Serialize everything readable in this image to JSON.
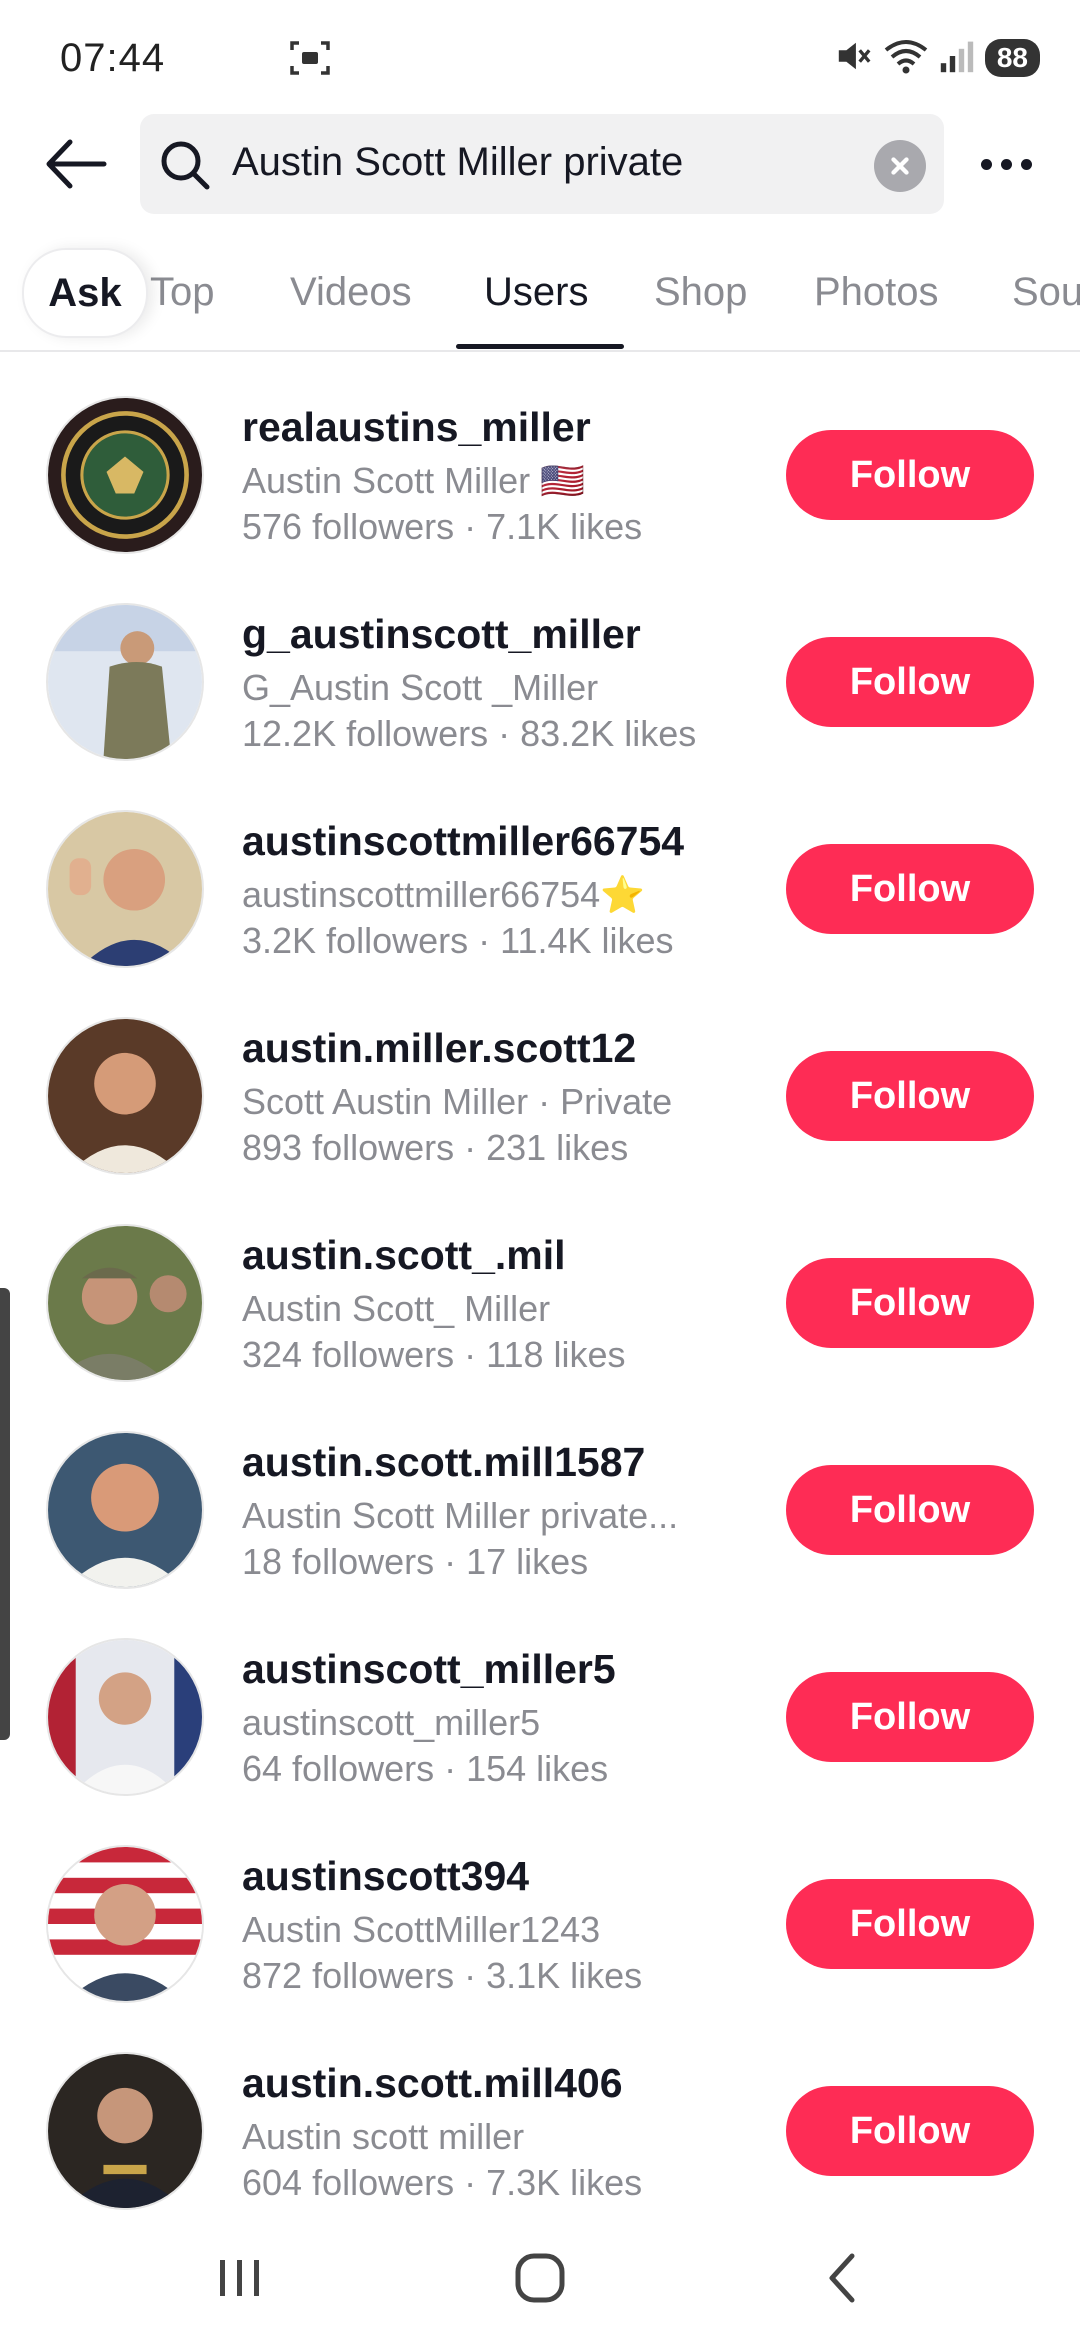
{
  "status_bar": {
    "time": "07:44",
    "battery": "88",
    "icons": [
      "screen-record-icon",
      "mute-icon",
      "wifi-icon",
      "signal-icon"
    ]
  },
  "search": {
    "query": "Austin Scott Miller private",
    "icons": [
      "back-arrow-icon",
      "search-icon",
      "clear-icon",
      "more-icon"
    ]
  },
  "tabs": [
    {
      "label": "Ask"
    },
    {
      "label": "Top"
    },
    {
      "label": "Videos"
    },
    {
      "label": "Users",
      "active": true
    },
    {
      "label": "Shop"
    },
    {
      "label": "Photos"
    },
    {
      "label": "Sou"
    }
  ],
  "users": [
    {
      "username": "realaustins_miller",
      "display": "Austin Scott Miller 🇺🇸",
      "stats": "576 followers · 7.1K likes",
      "follow_label": "Follow"
    },
    {
      "username": "g_austinscott_miller",
      "display": "G_Austin Scott _Miller",
      "stats": "12.2K followers · 83.2K likes",
      "follow_label": "Follow"
    },
    {
      "username": "austinscottmiller66754",
      "display": "austinscottmiller66754⭐",
      "stats": "3.2K followers · 11.4K likes",
      "follow_label": "Follow"
    },
    {
      "username": "austin.miller.scott12",
      "display": "Scott Austin Miller · Private",
      "stats": "893 followers · 231 likes",
      "follow_label": "Follow"
    },
    {
      "username": "austin.scott_.mil",
      "display": "Austin Scott_ Miller",
      "stats": "324 followers · 118 likes",
      "follow_label": "Follow"
    },
    {
      "username": "austin.scott.mill1587",
      "display": "Austin Scott Miller private...",
      "stats": "18 followers · 17 likes",
      "follow_label": "Follow"
    },
    {
      "username": "austinscott_miller5",
      "display": "austinscott_miller5",
      "stats": "64 followers · 154 likes",
      "follow_label": "Follow"
    },
    {
      "username": "austinscott394",
      "display": "Austin ScottMiller1243",
      "stats": "872 followers · 3.1K likes",
      "follow_label": "Follow"
    },
    {
      "username": "austin.scott.mill406",
      "display": "Austin scott miller",
      "stats": "604 followers · 7.3K likes",
      "follow_label": "Follow"
    }
  ],
  "colors": {
    "follow": "#fe2c55",
    "muted_text": "#8a8b91",
    "primary_text": "#161823"
  },
  "nav": {
    "icons": [
      "recent-apps-icon",
      "home-icon",
      "back-icon"
    ]
  }
}
